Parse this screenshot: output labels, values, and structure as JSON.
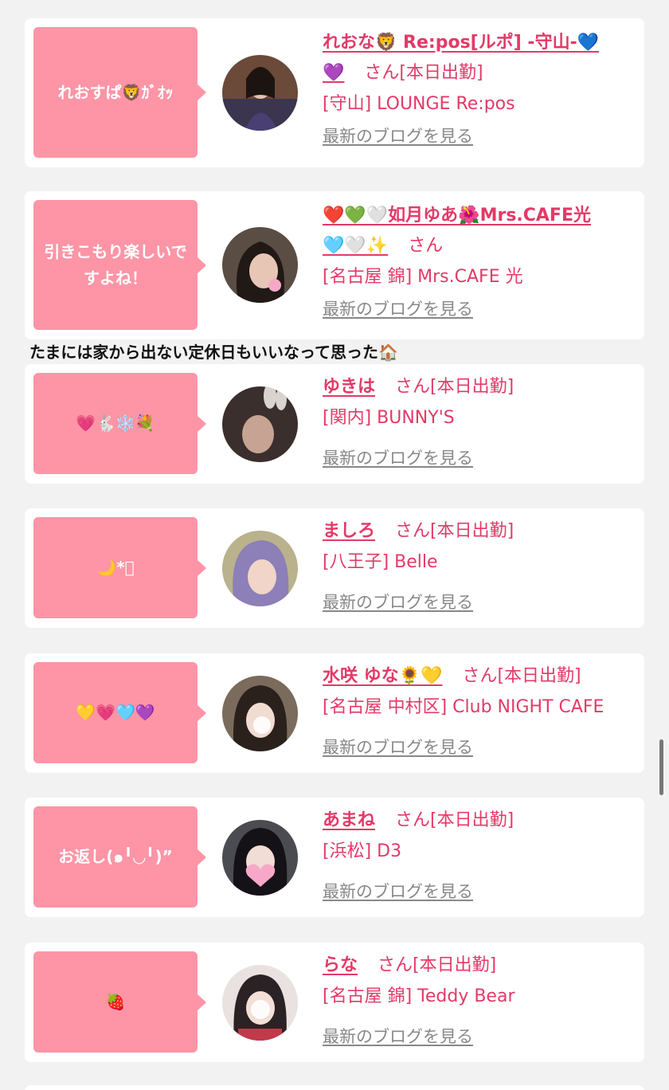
{
  "entries": [
    {
      "bubble": "れおすぱ🦁ｶﾞｵｯ",
      "name_l1": "れおな🦁 Re:pos[ルポ] -守山-💙",
      "name_l2": "💜",
      "san": "さん[本日出勤]",
      "shop": "[守山] LOUNGE Re:pos",
      "blog": "最新のブログを見る"
    },
    {
      "bubble": "引きこもり楽しいですよね！",
      "name_l1": "❤️💚🤍如月ゆあ🌺Mrs.CAFE光",
      "name_l2": "🩵🤍✨",
      "san": "さん",
      "shop": "[名古屋 錦] Mrs.CAFE 光",
      "blog": "最新のブログを見る"
    },
    {
      "bubble": "💗🐇❄️💐",
      "name_l1": "ゆきは",
      "san": "さん[本日出勤]",
      "shop": "[関内] BUNNY'S",
      "blog": "最新のブログを見る"
    },
    {
      "bubble": "🌙*ﾟ",
      "name_l1": "ましろ",
      "san": "さん[本日出勤]",
      "shop": "[八王子] Belle",
      "blog": "最新のブログを見る"
    },
    {
      "bubble": "💛💗🩵💜",
      "name_l1": "水咲 ゆな🌻💛",
      "san": "さん[本日出勤]",
      "shop": "[名古屋 中村区] Club NIGHT CAFE",
      "blog": "最新のブログを見る"
    },
    {
      "bubble": "お返し(๑╹◡╹)”",
      "name_l1": "あまね",
      "san": "さん[本日出勤]",
      "shop": "[浜松] D3",
      "blog": "最新のブログを見る"
    },
    {
      "bubble": "🍓",
      "name_l1": "らな",
      "san": "さん[本日出勤]",
      "shop": "[名古屋 錦] Teddy Bear",
      "blog": "最新のブログを見る"
    }
  ],
  "comment": "たまには家から出ない定休日もいいなって思った🏠",
  "colors": {
    "accent": "#e23a67",
    "bubble": "#fd95a6",
    "background": "#f2f2f2",
    "muted": "#888888"
  }
}
